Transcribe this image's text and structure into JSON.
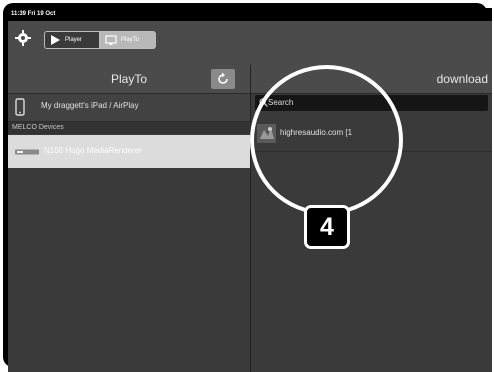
{
  "status_bar": {
    "time": "11:39 Fri 19 Oct"
  },
  "toolbar": {
    "segments": [
      {
        "label": "Player",
        "icon": "play-icon"
      },
      {
        "label": "PlayTo",
        "icon": "cast-icon"
      }
    ]
  },
  "left_panel": {
    "title": "PlayTo",
    "refresh_icon": "refresh-icon",
    "local_device": {
      "label": "My draggett's iPad / AirPlay",
      "icon": "ipad-icon"
    },
    "section_header": "MELCO Devices",
    "renderer": {
      "label": "N100 Hugo MediaRenderer",
      "icon": "renderer-icon"
    }
  },
  "right_panel": {
    "title": "download",
    "search": {
      "placeholder": "Search"
    },
    "servers": [
      {
        "label": "highresaudio.com [1"
      }
    ]
  },
  "callout": {
    "number": "4"
  }
}
